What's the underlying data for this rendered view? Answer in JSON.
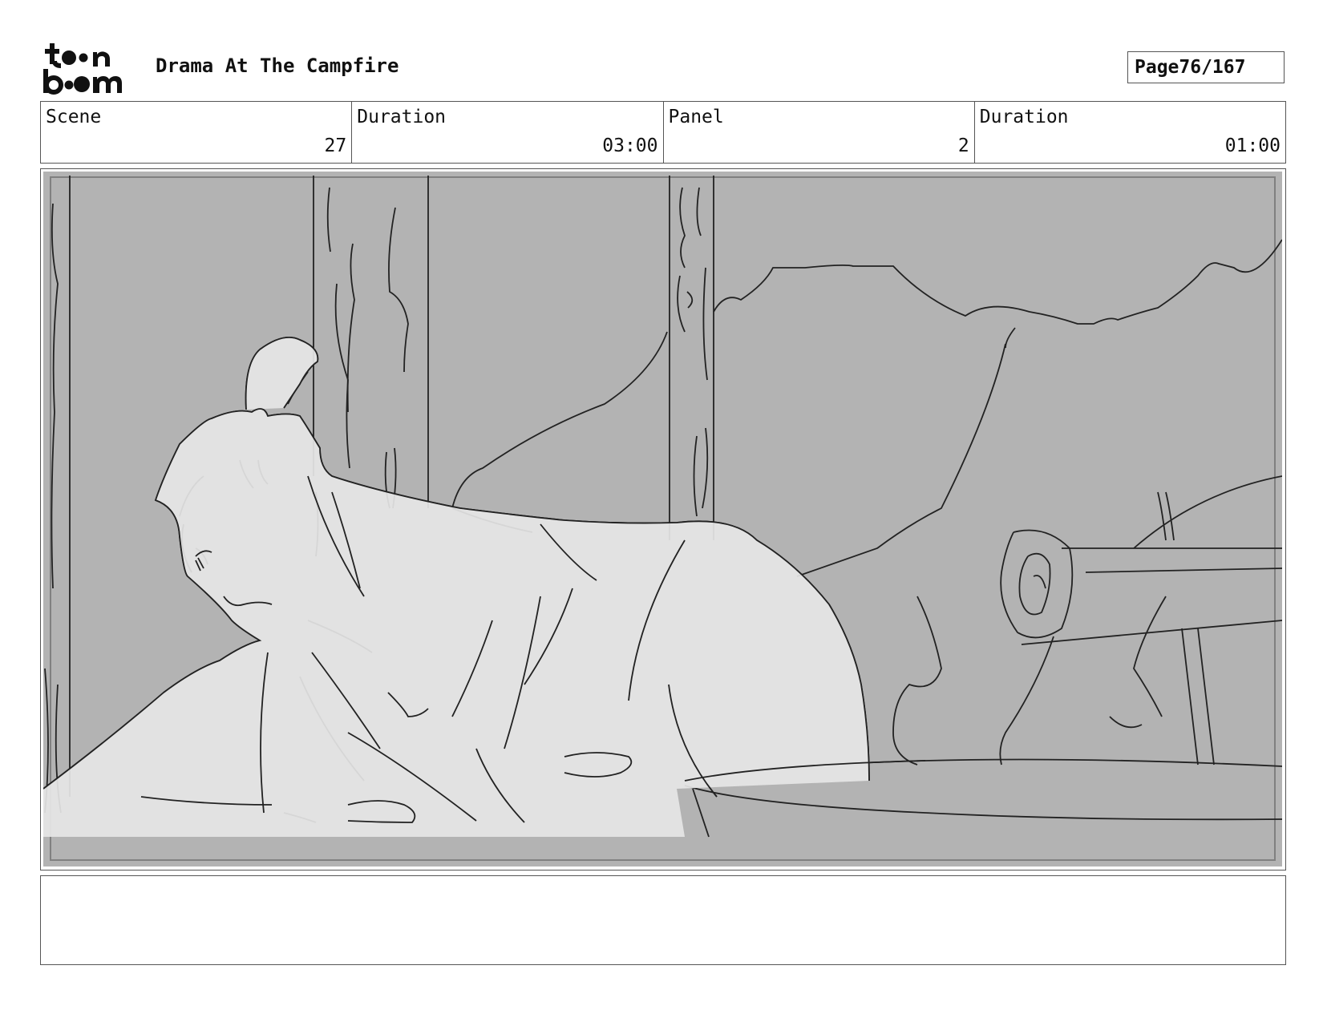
{
  "header": {
    "logo_text": "toonboom",
    "title": "Drama At The Campfire",
    "page_label": "Page",
    "page_value": "76/167"
  },
  "info": {
    "scene_label": "Scene",
    "scene_value": "27",
    "scene_duration_label": "Duration",
    "scene_duration_value": "03:00",
    "panel_label": "Panel",
    "panel_value": "2",
    "panel_duration_label": "Duration",
    "panel_duration_value": "01:00"
  },
  "panel": {
    "background_color": "#b3b3b3",
    "figure_color": "#e6e6e6",
    "line_color": "#222222"
  },
  "notes": {
    "text": ""
  }
}
